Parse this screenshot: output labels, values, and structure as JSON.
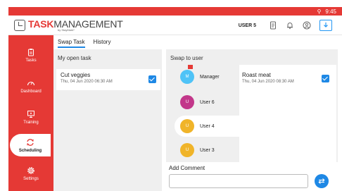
{
  "status_bar": {
    "time": "9:45"
  },
  "header": {
    "brand_part1": "TASK",
    "brand_part2": "MANAGEMENT",
    "brand_by": "by StayMark*",
    "username": "USER 5"
  },
  "sidebar": {
    "items": [
      {
        "label": "Tasks",
        "icon": "clipboard-icon"
      },
      {
        "label": "Dashboard",
        "icon": "gauge-icon"
      },
      {
        "label": "Training",
        "icon": "presentation-icon"
      },
      {
        "label": "Scheduling",
        "icon": "sync-icon",
        "active": true
      },
      {
        "label": "Settings",
        "icon": "gear-icon"
      }
    ]
  },
  "tabs": [
    {
      "label": "Swap Task",
      "active": true
    },
    {
      "label": "History",
      "active": false
    }
  ],
  "open_task_panel": {
    "title": "My open task",
    "task": {
      "name": "Cut veggies",
      "date": "Thu, 04 Jun 2020  06:30 AM",
      "checked": true
    }
  },
  "swap_panel": {
    "title": "Swap to user",
    "users": [
      {
        "initial": "M",
        "name": "Manager",
        "color": "#4fc3f7",
        "flagged": true
      },
      {
        "initial": "U",
        "name": "User 6",
        "color": "#c2378a"
      },
      {
        "initial": "U",
        "name": "User 4",
        "color": "#f0b429",
        "selected": true
      },
      {
        "initial": "U",
        "name": "User 3",
        "color": "#f0b429"
      }
    ],
    "task": {
      "name": "Roast meat",
      "date": "Thu, 04 Jun 2020  08:30 AM",
      "checked": true
    }
  },
  "comment": {
    "label": "Add Comment",
    "value": ""
  },
  "colors": {
    "brand_red": "#e53935",
    "accent_blue": "#1e88e5"
  }
}
